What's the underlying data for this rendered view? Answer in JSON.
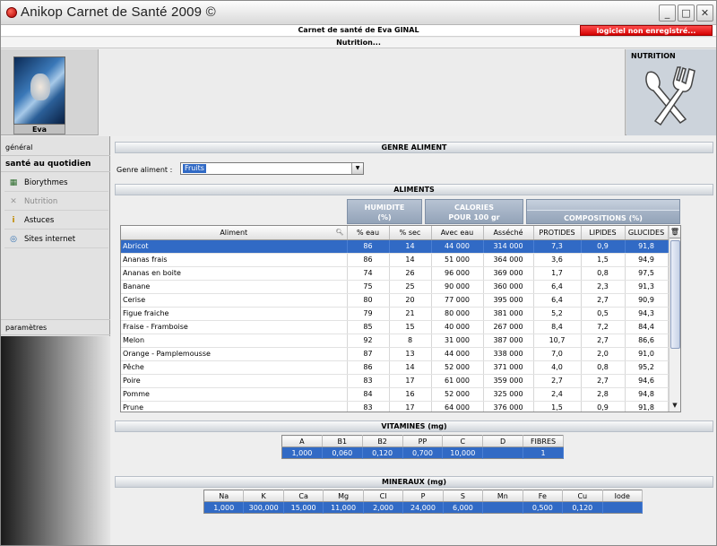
{
  "window": {
    "title": "Anikop Carnet de Santé 2009 ©",
    "min": "_",
    "max": "□",
    "close": "✕"
  },
  "header": {
    "patient_title": "Carnet de santé de Eva GINAL",
    "unregistered": "logiciel non enregistré...",
    "section": "Nutrition..."
  },
  "profile": {
    "name": "Eva"
  },
  "module": {
    "title": "NUTRITION",
    "icon": "fork-spoon-icon"
  },
  "sidebar": {
    "general": "général",
    "sante": "santé au quotidien",
    "items": [
      {
        "label": "Biorythmes",
        "icon": "▦",
        "enabled": true
      },
      {
        "label": "Nutrition",
        "icon": "✕",
        "enabled": false
      },
      {
        "label": "Astuces",
        "icon": "i",
        "enabled": true
      },
      {
        "label": "Sites internet",
        "icon": "◎",
        "enabled": true
      }
    ],
    "params": "paramètres"
  },
  "genre": {
    "section_title": "GENRE ALIMENT",
    "label": "Genre aliment :",
    "selected": "Fruits"
  },
  "aliments": {
    "section_title": "ALIMENTS",
    "groups": {
      "humidite": "HUMIDITE",
      "humidite_unit": "(%)",
      "calories": "CALORIES",
      "calories_unit": "POUR 100 gr",
      "compositions": "COMPOSITIONS (%)"
    },
    "columns": [
      "Aliment",
      "% eau",
      "% sec",
      "Avec eau",
      "Asséché",
      "PROTIDES",
      "LIPIDES",
      "GLUCIDES"
    ],
    "rows": [
      [
        "Abricot",
        "86",
        "14",
        "44 000",
        "314 000",
        "7,3",
        "0,9",
        "91,8"
      ],
      [
        "Ananas frais",
        "86",
        "14",
        "51 000",
        "364 000",
        "3,6",
        "1,5",
        "94,9"
      ],
      [
        "Ananas en boite",
        "74",
        "26",
        "96 000",
        "369 000",
        "1,7",
        "0,8",
        "97,5"
      ],
      [
        "Banane",
        "75",
        "25",
        "90 000",
        "360 000",
        "6,4",
        "2,3",
        "91,3"
      ],
      [
        "Cerise",
        "80",
        "20",
        "77 000",
        "395 000",
        "6,4",
        "2,7",
        "90,9"
      ],
      [
        "Figue fraiche",
        "79",
        "21",
        "80 000",
        "381 000",
        "5,2",
        "0,5",
        "94,3"
      ],
      [
        "Fraise - Framboise",
        "85",
        "15",
        "40 000",
        "267 000",
        "8,4",
        "7,2",
        "84,4"
      ],
      [
        "Melon",
        "92",
        "8",
        "31 000",
        "387 000",
        "10,7",
        "2,7",
        "86,6"
      ],
      [
        "Orange - Pamplemousse",
        "87",
        "13",
        "44 000",
        "338 000",
        "7,0",
        "2,0",
        "91,0"
      ],
      [
        "Pêche",
        "86",
        "14",
        "52 000",
        "371 000",
        "4,0",
        "0,8",
        "95,2"
      ],
      [
        "Poire",
        "83",
        "17",
        "61 000",
        "359 000",
        "2,7",
        "2,7",
        "94,6"
      ],
      [
        "Pomme",
        "84",
        "16",
        "52 000",
        "325 000",
        "2,4",
        "2,8",
        "94,8"
      ],
      [
        "Prune",
        "83",
        "17",
        "64 000",
        "376 000",
        "1,5",
        "0,9",
        "91,8"
      ]
    ],
    "selected_row": 0
  },
  "vitamines": {
    "section_title": "VITAMINES (mg)",
    "columns": [
      "A",
      "B1",
      "B2",
      "PP",
      "C",
      "D",
      "FIBRES"
    ],
    "values": [
      "1,000",
      "0,060",
      "0,120",
      "0,700",
      "10,000",
      "",
      "1"
    ]
  },
  "mineraux": {
    "section_title": "MINERAUX (mg)",
    "columns": [
      "Na",
      "K",
      "Ca",
      "Mg",
      "Cl",
      "P",
      "S",
      "Mn",
      "Fe",
      "Cu",
      "Iode"
    ],
    "values": [
      "1,000",
      "300,000",
      "15,000",
      "11,000",
      "2,000",
      "24,000",
      "6,000",
      "",
      "0,500",
      "0,120",
      ""
    ]
  }
}
